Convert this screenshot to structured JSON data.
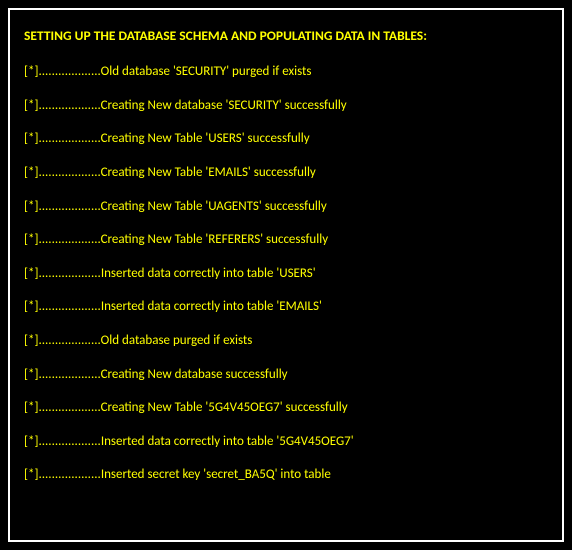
{
  "heading": "SETTING UP THE DATABASE SCHEMA AND POPULATING DATA IN TABLES:",
  "log_prefix": "[*]...................",
  "log_lines": [
    "Old database 'SECURITY' purged if exists",
    "Creating New database 'SECURITY' successfully",
    "Creating New Table 'USERS' successfully",
    "Creating New Table 'EMAILS' successfully",
    "Creating New Table 'UAGENTS' successfully",
    "Creating New Table 'REFERERS' successfully",
    "Inserted data correctly into table 'USERS'",
    "Inserted data correctly into table 'EMAILS'",
    "Old database purged if exists",
    "Creating New database successfully",
    "Creating New Table '5G4V45OEG7' successfully",
    "Inserted data correctly into table '5G4V45OEG7'",
    "Inserted secret key 'secret_BA5Q' into table"
  ]
}
